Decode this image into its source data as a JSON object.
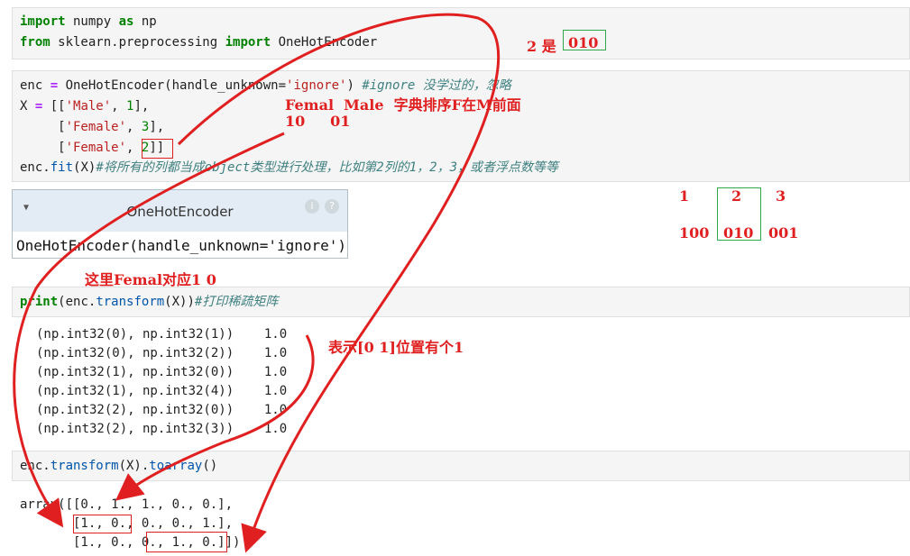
{
  "cell1": {
    "line1": {
      "kw1": "import",
      "mod": " numpy ",
      "kw2": "as",
      "alias": " np"
    },
    "line2": {
      "kw1": "from",
      "mod": " sklearn.preprocessing ",
      "kw2": "import",
      "cls": " OneHotEncoder"
    }
  },
  "cell2": {
    "line1": {
      "a": "enc ",
      "eq": "=",
      "b": " OneHotEncoder(handle_unknown=",
      "s": "'ignore'",
      "c": ") ",
      "cmt": "#ignore 没学过的，忽略"
    },
    "line2": {
      "a": "X ",
      "eq": "=",
      "b": " [[",
      "s": "'Male'",
      "c": ", ",
      "n": "1",
      "d": "],"
    },
    "line3": {
      "a": "     [",
      "s": "'Female'",
      "c": ", ",
      "n": "3",
      "d": "],"
    },
    "line4": {
      "a": "     [",
      "s": "'Female'",
      "c": ", ",
      "n": "2",
      "d": "]]"
    },
    "line5": {
      "a": "enc.",
      "fn": "fit",
      "b": "(X)",
      "cmt": "#将所有的列都当成object类型进行处理，比如第2列的1，2，3，或者浮点数等等"
    }
  },
  "widget": {
    "title": "OneHotEncoder",
    "help1": "i",
    "help2": "?",
    "body": "OneHotEncoder(handle_unknown='ignore')"
  },
  "cell3": {
    "a": "print",
    "b": "(enc.",
    "fn": "transform",
    "c": "(X))",
    "cmt": "#打印稀疏矩阵"
  },
  "sparse_output": [
    "(np.int32(0), np.int32(1))    1.0",
    "(np.int32(0), np.int32(2))    1.0",
    "(np.int32(1), np.int32(0))    1.0",
    "(np.int32(1), np.int32(4))    1.0",
    "(np.int32(2), np.int32(0))    1.0",
    "(np.int32(2), np.int32(3))    1.0"
  ],
  "cell4": {
    "a": "enc.",
    "fn1": "transform",
    "b": "(X).",
    "fn2": "toarray",
    "c": "()"
  },
  "array_output": [
    "array([[0., 1., 1., 0., 0.],",
    "       [1., 0., 0., 0., 1.],",
    "       [1., 0., 0., 1., 0.]])"
  ],
  "annotations": {
    "two_is": "2 是",
    "two_is_val": "010",
    "femal_male": "Femal  Male  字典排序F在M前面",
    "codes": "10     01",
    "femal_1_0": "这里Femal对应1 0",
    "pos_note": "表示[0 1]位置有个1",
    "col_nums": [
      "1",
      "2",
      "3"
    ],
    "col_codes": [
      "100",
      "010",
      "001"
    ]
  },
  "colors": {
    "annotation": "#e02020",
    "green_box": "#2ea84a",
    "red_box": "#e02020",
    "cell_bg": "#f5f5f5"
  }
}
